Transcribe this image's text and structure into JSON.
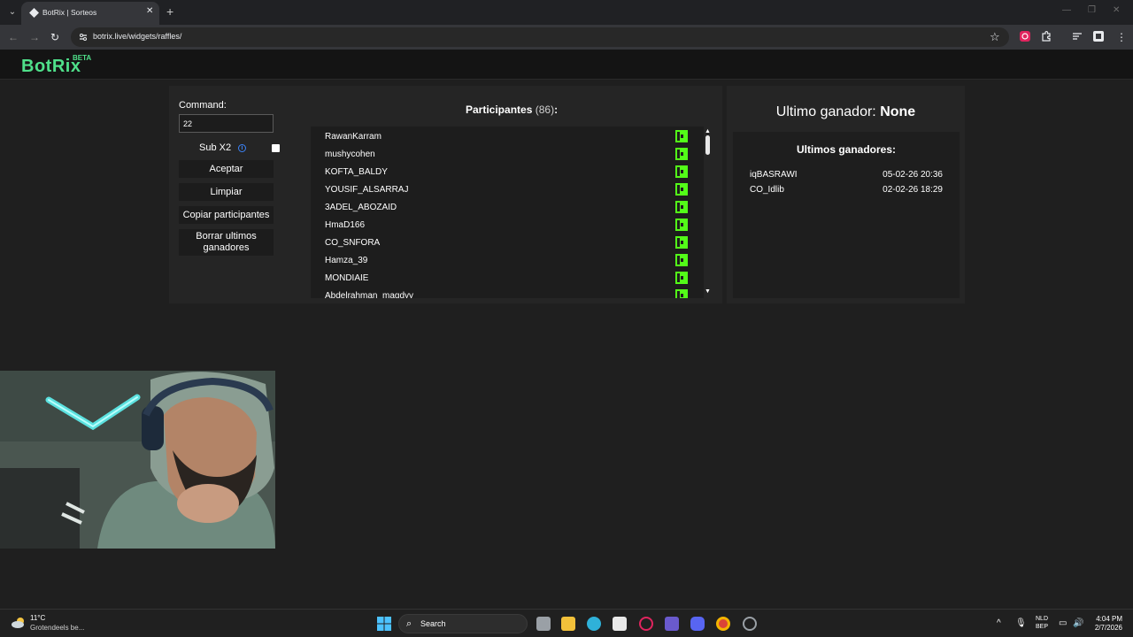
{
  "browser": {
    "tab_title": "BotRix | Sorteos",
    "url": "botrix.live/widgets/raffles/"
  },
  "site": {
    "logo": "BotRix",
    "badge": "BETA",
    "accent_color": "#4fe08a"
  },
  "raffle": {
    "command_label": "Command:",
    "command_value": "22",
    "sub_label": "Sub X2",
    "sub_checked": false,
    "buttons": {
      "accept": "Aceptar",
      "clear": "Limpiar",
      "copy": "Copiar participantes",
      "clear_winners": "Borrar ultimos ganadores"
    }
  },
  "participants": {
    "title": "Participantes",
    "count": "(86)",
    "suffix": ":",
    "platform_icon": "kick-icon",
    "items": [
      "RawanKarram",
      "mushycohen",
      "KOFTA_BALDY",
      "YOUSIF_ALSARRAJ",
      "3ADEL_ABOZAID",
      "HmaD166",
      "CO_SNFORA",
      "Hamza_39",
      "MONDIAIE",
      "Abdelrahman_magdyy"
    ]
  },
  "winners": {
    "last_label": "Ultimo ganador:",
    "last_value": "None",
    "recent_title": "Ultimos ganadores:",
    "items": [
      {
        "name": "iqBASRAWI",
        "date": "05-02-26 20:36"
      },
      {
        "name": "CO_Idlib",
        "date": "02-02-26 18:29"
      }
    ]
  },
  "taskbar": {
    "weather_temp": "11°C",
    "weather_desc": "Grotendeels be...",
    "search": "Search",
    "lang_1": "NLD",
    "lang_2": "BEP",
    "time": "4:04 PM",
    "date": "2/7/2026"
  }
}
